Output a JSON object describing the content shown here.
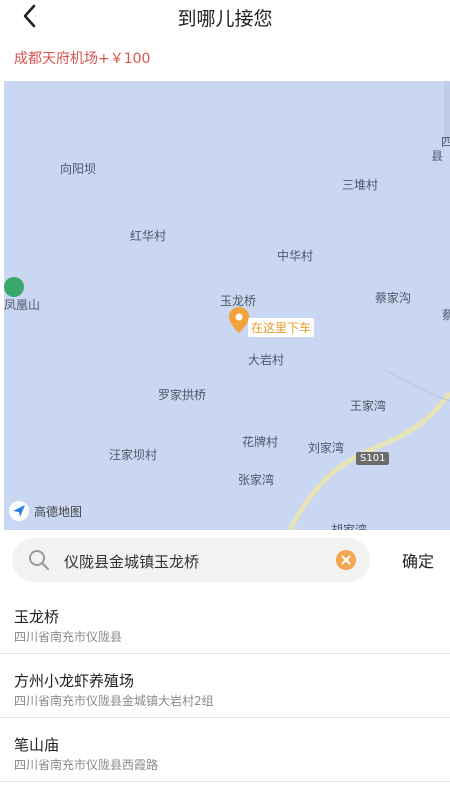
{
  "header": {
    "title": "到哪儿接您"
  },
  "route": {
    "text": "成都天府机场+￥100"
  },
  "map": {
    "labels": {
      "p1": "四",
      "p2": "县",
      "p3": "向阳坝",
      "p4": "三堆村",
      "p5": "红华村",
      "p6": "中华村",
      "p7": "凤凰山",
      "p8": "玉龙桥",
      "p9": "蔡家沟",
      "p10": "蔡",
      "p11": "大岩村",
      "p12": "罗家拱桥",
      "p13": "王家湾",
      "p14": "花牌村",
      "p15": "刘家湾",
      "p16": "汪家坝村",
      "p17": "张家湾",
      "p18": "胡家湾"
    },
    "callout": "在这里下车",
    "road_badge": "S101",
    "logo_text": "高德地图"
  },
  "search": {
    "value": "仪陇县金城镇玉龙桥",
    "confirm_label": "确定"
  },
  "results": [
    {
      "name": "玉龙桥",
      "address": "四川省南充市仪陇县"
    },
    {
      "name": "方州小龙虾养殖场",
      "address": "四川省南充市仪陇县金城镇大岩村2组"
    },
    {
      "name": "笔山庙",
      "address": "四川省南充市仪陇县西霞路"
    }
  ]
}
